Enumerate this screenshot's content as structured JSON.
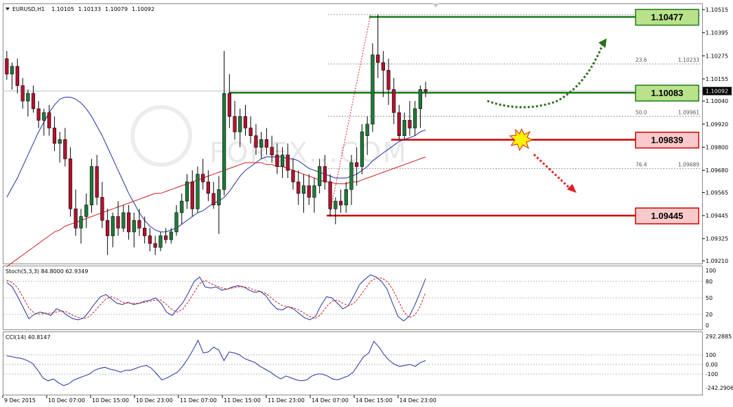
{
  "header": {
    "symbol": "EURUSD,H1",
    "open": "1.10105",
    "high": "1.10133",
    "low": "1.10079",
    "close": "1.10092"
  },
  "watermark": "FOREX...COM",
  "chart_data": [
    {
      "type": "candlestick",
      "title": "EURUSD,H1  1.10105 1.10133 1.10079 1.10092",
      "ylim": [
        1.0921,
        1.10515
      ],
      "y_ticks": [
        "1.10515",
        "1.10395",
        "1.10275",
        "1.10155",
        "1.10040",
        "1.09920",
        "1.09800",
        "1.09680",
        "1.09565",
        "1.09445",
        "1.09325",
        "1.09210"
      ],
      "current_price": "1.10092",
      "candles": [
        [
          1.1026,
          1.103,
          1.1015,
          1.1018
        ],
        [
          1.1018,
          1.1024,
          1.101,
          1.1022
        ],
        [
          1.1022,
          1.1026,
          1.1008,
          1.1012
        ],
        [
          1.1012,
          1.1016,
          1.1,
          1.1004
        ],
        [
          1.1004,
          1.101,
          1.0996,
          1.1008
        ],
        [
          1.1008,
          1.1012,
          1.0998,
          1.1
        ],
        [
          1.1,
          1.1004,
          1.099,
          1.0994
        ],
        [
          1.0994,
          1.1,
          1.0986,
          1.0998
        ],
        [
          1.0998,
          1.1002,
          1.0986,
          1.099
        ],
        [
          1.099,
          1.0996,
          1.0978,
          1.0982
        ],
        [
          1.0982,
          1.0988,
          1.0972,
          1.0984
        ],
        [
          1.0984,
          1.099,
          1.097,
          1.0974
        ],
        [
          1.0974,
          1.098,
          1.0944,
          1.0948
        ],
        [
          1.0948,
          1.0958,
          1.0934,
          1.0938
        ],
        [
          1.0938,
          1.0948,
          1.093,
          1.0944
        ],
        [
          1.0944,
          1.0956,
          1.0938,
          1.095
        ],
        [
          1.095,
          1.0974,
          1.0946,
          1.097
        ],
        [
          1.097,
          1.0976,
          1.095,
          1.0954
        ],
        [
          1.0954,
          1.0962,
          1.0938,
          1.0942
        ],
        [
          1.0942,
          1.0948,
          1.0924,
          1.0934
        ],
        [
          1.0934,
          1.0946,
          1.0928,
          1.0944
        ],
        [
          1.0944,
          1.0952,
          1.0934,
          1.0938
        ],
        [
          1.0938,
          1.095,
          1.0936,
          1.0946
        ],
        [
          1.0946,
          1.095,
          1.0932,
          1.0936
        ],
        [
          1.0936,
          1.0946,
          1.0928,
          1.0942
        ],
        [
          1.0942,
          1.0948,
          1.0934,
          1.0938
        ],
        [
          1.0938,
          1.0944,
          1.093,
          1.0934
        ],
        [
          1.0934,
          1.0938,
          1.0926,
          1.093
        ],
        [
          1.093,
          1.0934,
          1.0924,
          1.0928
        ],
        [
          1.0928,
          1.0936,
          1.0926,
          1.0934
        ],
        [
          1.0934,
          1.0938,
          1.093,
          1.0932
        ],
        [
          1.0932,
          1.0938,
          1.093,
          1.0936
        ],
        [
          1.0936,
          1.095,
          1.0934,
          1.0946
        ],
        [
          1.0946,
          1.0956,
          1.094,
          1.0952
        ],
        [
          1.0952,
          1.0966,
          1.0948,
          1.0962
        ],
        [
          1.0962,
          1.0968,
          1.0944,
          1.0948
        ],
        [
          1.0948,
          1.097,
          1.0946,
          1.0966
        ],
        [
          1.0966,
          1.0974,
          1.0958,
          1.0962
        ],
        [
          1.0962,
          1.0968,
          1.0952,
          1.0956
        ],
        [
          1.0956,
          1.0962,
          1.0948,
          1.095
        ],
        [
          1.095,
          1.0965,
          1.0935,
          1.0958
        ],
        [
          1.0958,
          1.103,
          1.0955,
          1.1008
        ],
        [
          1.1008,
          1.1018,
          1.099,
          1.0996
        ],
        [
          1.0996,
          1.1004,
          1.0984,
          1.0988
        ],
        [
          1.0988,
          1.1,
          1.098,
          1.0996
        ],
        [
          1.0996,
          1.1002,
          1.0986,
          1.099
        ],
        [
          1.099,
          1.0996,
          1.0982,
          1.0986
        ],
        [
          1.0986,
          1.0992,
          1.0976,
          1.098
        ],
        [
          1.098,
          1.0988,
          1.0974,
          1.0984
        ],
        [
          1.0984,
          1.099,
          1.0976,
          1.098
        ],
        [
          1.098,
          1.0986,
          1.0972,
          1.0976
        ],
        [
          1.0976,
          1.0982,
          1.0966,
          1.097
        ],
        [
          1.097,
          1.098,
          1.0964,
          1.0976
        ],
        [
          1.0976,
          1.0982,
          1.0964,
          1.0968
        ],
        [
          1.0968,
          1.0974,
          1.0958,
          1.0962
        ],
        [
          1.0962,
          1.0968,
          1.095,
          1.0956
        ],
        [
          1.0956,
          1.0966,
          1.0946,
          1.096
        ],
        [
          1.096,
          1.0966,
          1.095,
          1.0954
        ],
        [
          1.0954,
          1.0964,
          1.0946,
          1.096
        ],
        [
          1.096,
          1.0974,
          1.0956,
          1.097
        ],
        [
          1.097,
          1.0976,
          1.0958,
          1.0962
        ],
        [
          1.0962,
          1.0966,
          1.0944,
          1.0948
        ],
        [
          1.0948,
          1.0954,
          1.094,
          1.0952
        ],
        [
          1.0952,
          1.0958,
          1.0946,
          1.095
        ],
        [
          1.095,
          1.0962,
          1.0946,
          1.0958
        ],
        [
          1.0958,
          1.0976,
          1.095,
          1.0972
        ],
        [
          1.0972,
          1.098,
          1.096,
          1.097
        ],
        [
          1.097,
          1.0992,
          1.0966,
          1.0988
        ],
        [
          1.0986,
          1.0996,
          1.0976,
          1.0992
        ],
        [
          1.0992,
          1.1034,
          1.0988,
          1.1028
        ],
        [
          1.1028,
          1.1049,
          1.1016,
          1.1024
        ],
        [
          1.1024,
          1.103,
          1.1006,
          1.102
        ],
        [
          1.102,
          1.1026,
          1.1002,
          1.101
        ],
        [
          1.101,
          1.1016,
          1.0992,
          1.0998
        ],
        [
          1.0998,
          1.1002,
          1.0984,
          1.0986
        ],
        [
          1.0986,
          1.0998,
          1.0984,
          1.0994
        ],
        [
          1.0994,
          1.1004,
          1.0986,
          1.099
        ],
        [
          1.099,
          1.1004,
          1.0986,
          1.1
        ],
        [
          1.1,
          1.1012,
          1.099,
          1.101
        ],
        [
          1.101,
          1.1014,
          1.1006,
          1.1009
        ]
      ],
      "moving_averages": [
        {
          "color": "#1f2fa0",
          "values": [
            1.0954,
            1.0959,
            1.0964,
            1.097,
            1.0976,
            1.0982,
            1.0988,
            1.0993,
            1.0998,
            1.1002,
            1.1005,
            1.1006,
            1.1006,
            1.1005,
            1.1003,
            1.1,
            1.0996,
            1.0991,
            1.0986,
            1.098,
            1.0974,
            1.0968,
            1.0962,
            1.0956,
            1.0951,
            1.0946,
            1.0942,
            1.0939,
            1.0937,
            1.0936,
            1.0936,
            1.0937,
            1.0938,
            1.094,
            1.0942,
            1.0944,
            1.0946,
            1.0947,
            1.0949,
            1.0951,
            1.0952,
            1.0954,
            1.0957,
            1.0961,
            1.0965,
            1.0968,
            1.097,
            1.0972,
            1.0974,
            1.0975,
            1.0975,
            1.0975,
            1.0975,
            1.0974,
            1.0974,
            1.0973,
            1.0971,
            1.0969,
            1.0968,
            1.0967,
            1.0966,
            1.0965,
            1.0964,
            1.0964,
            1.0964,
            1.0965,
            1.0966,
            1.0968,
            1.097,
            1.0973,
            1.0975,
            1.0977,
            1.0979,
            1.0981,
            1.0983,
            1.0984,
            1.0985,
            1.0986,
            1.0988,
            1.0989
          ]
        },
        {
          "color": "#cc1b1b",
          "values": [
            1.0918,
            1.092,
            1.0922,
            1.0924,
            1.0926,
            1.0928,
            1.093,
            1.0932,
            1.0934,
            1.0936,
            1.0937,
            1.0939,
            1.094,
            1.0941,
            1.0942,
            1.0943,
            1.0944,
            1.0945,
            1.0946,
            1.0947,
            1.0948,
            1.0949,
            1.095,
            1.0951,
            1.0952,
            1.0953,
            1.0954,
            1.0955,
            1.0956,
            1.0956,
            1.0957,
            1.0958,
            1.0959,
            1.096,
            1.0961,
            1.0962,
            1.0963,
            1.0964,
            1.0965,
            1.0966,
            1.0967,
            1.0968,
            1.0969,
            1.097,
            1.0971,
            1.0972,
            1.0972,
            1.0972,
            1.0972,
            1.0971,
            1.0971,
            1.097,
            1.097,
            1.0969,
            1.0968,
            1.0967,
            1.0966,
            1.0965,
            1.0964,
            1.0963,
            1.0962,
            1.0962,
            1.0961,
            1.0961,
            1.0961,
            1.0962,
            1.0962,
            1.0963,
            1.0964,
            1.0965,
            1.0966,
            1.0967,
            1.0968,
            1.0969,
            1.097,
            1.0971,
            1.0972,
            1.0973,
            1.0974,
            1.0975
          ]
        }
      ],
      "levels": [
        {
          "value": "1.10477",
          "kind": "resistance",
          "color": "#1a7a1a",
          "fill": "#b9e28a"
        },
        {
          "value": "1.10083",
          "kind": "resistance",
          "color": "#1a7a1a",
          "fill": "#b9e28a"
        },
        {
          "value": "1.09839",
          "kind": "support",
          "color": "#cc0000",
          "fill": "#fbc9c9"
        },
        {
          "value": "1.09445",
          "kind": "support",
          "color": "#cc0000",
          "fill": "#fbc9c9"
        }
      ],
      "fib_levels": [
        {
          "label": "23.6",
          "price": "1.10233",
          "y": 1.10233
        },
        {
          "label": "50.0",
          "price": "1.09961",
          "y": 1.09961
        },
        {
          "label": "76.4",
          "price": "1.09689",
          "y": 1.09689
        }
      ],
      "fib_high": 1.10489,
      "fib_low": 1.09445
    },
    {
      "type": "line",
      "title": "Stoch(5,3,3) 84.8000 62.9349",
      "ylim": [
        0,
        100
      ],
      "y_ticks": [
        "100",
        "80",
        "50",
        "20",
        "0"
      ],
      "series": [
        {
          "color": "#1f2fa0",
          "values": [
            78,
            70,
            52,
            32,
            12,
            20,
            24,
            22,
            18,
            30,
            26,
            18,
            12,
            10,
            14,
            26,
            40,
            52,
            56,
            48,
            40,
            38,
            42,
            38,
            40,
            44,
            46,
            50,
            40,
            24,
            18,
            30,
            42,
            60,
            80,
            88,
            70,
            68,
            70,
            64,
            66,
            70,
            72,
            70,
            64,
            60,
            62,
            54,
            40,
            30,
            28,
            34,
            30,
            22,
            14,
            10,
            16,
            36,
            52,
            50,
            40,
            30,
            36,
            54,
            74,
            84,
            92,
            88,
            80,
            66,
            40,
            16,
            8,
            16,
            36,
            60,
            85
          ]
        },
        {
          "color": "#cc1b1b",
          "values": [
            82,
            78,
            68,
            50,
            32,
            22,
            20,
            22,
            22,
            24,
            26,
            24,
            18,
            14,
            12,
            16,
            26,
            38,
            48,
            52,
            48,
            42,
            40,
            40,
            40,
            42,
            44,
            46,
            46,
            38,
            28,
            24,
            30,
            44,
            60,
            76,
            82,
            76,
            72,
            68,
            66,
            68,
            70,
            70,
            68,
            64,
            62,
            58,
            50,
            42,
            36,
            34,
            32,
            28,
            22,
            16,
            12,
            20,
            34,
            44,
            46,
            40,
            36,
            40,
            52,
            66,
            80,
            86,
            86,
            80,
            66,
            46,
            26,
            14,
            18,
            34,
            60
          ]
        }
      ]
    },
    {
      "type": "line",
      "title": "CCI(14) 40.8147",
      "ylim": [
        -242.2906,
        292.2885
      ],
      "y_ticks": [
        "292.2885",
        "100",
        "0.00",
        "-100",
        "-242.2906"
      ],
      "series": [
        {
          "color": "#1f2fa0",
          "values": [
            90,
            80,
            70,
            60,
            40,
            10,
            -60,
            -140,
            -170,
            -150,
            -190,
            -220,
            -200,
            -160,
            -140,
            -120,
            -100,
            -60,
            -40,
            -30,
            -50,
            -60,
            -80,
            -60,
            -60,
            -40,
            -20,
            -10,
            -40,
            -100,
            -160,
            -140,
            -110,
            -80,
            -20,
            60,
            150,
            250,
            120,
            130,
            180,
            150,
            40,
            130,
            120,
            100,
            60,
            40,
            20,
            -20,
            -50,
            -80,
            -120,
            -150,
            -120,
            -140,
            -160,
            -170,
            -160,
            -120,
            -100,
            -100,
            -120,
            -150,
            -160,
            -140,
            -120,
            -80,
            0,
            80,
            120,
            240,
            180,
            100,
            40,
            0,
            -20,
            -10,
            0,
            -20,
            20,
            40
          ]
        }
      ]
    }
  ],
  "x_axis": {
    "labels": [
      "9 Dec 2015",
      "10 Dec 07:00",
      "10 Dec 15:00",
      "10 Dec 23:00",
      "11 Dec 07:00",
      "11 Dec 15:00",
      "11 Dec 23:00",
      "14 Dec 07:00",
      "14 Dec 15:00",
      "14 Dec 23:00"
    ]
  }
}
